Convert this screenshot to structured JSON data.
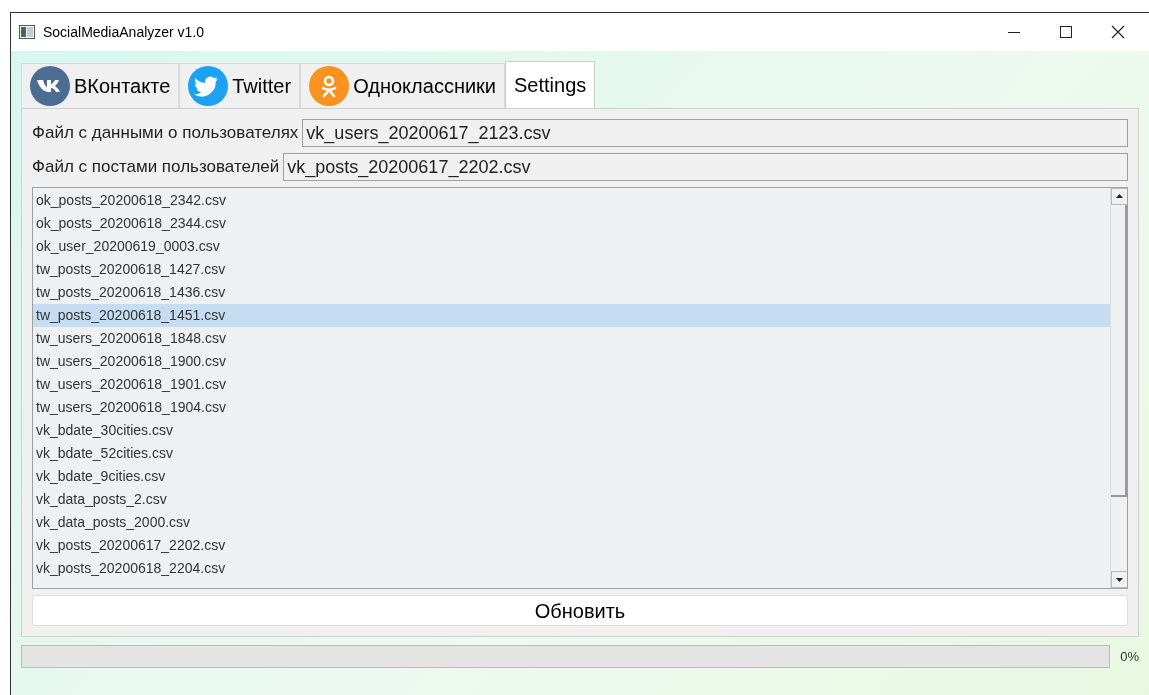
{
  "window": {
    "title": "SocialMediaAnalyzer v1.0"
  },
  "tabs": [
    {
      "label": "ВКонтакте",
      "kind": "vk",
      "selected": false
    },
    {
      "label": "Twitter",
      "kind": "twitter",
      "selected": false
    },
    {
      "label": "Одноклассники",
      "kind": "ok",
      "selected": false
    },
    {
      "label": "Settings",
      "kind": "plain",
      "selected": true
    }
  ],
  "fields": [
    {
      "label": "Файл с данными о пользователях",
      "value": "vk_users_20200617_2123.csv"
    },
    {
      "label": "Файл с постами пользователей",
      "value": "vk_posts_20200617_2202.csv"
    }
  ],
  "files": [
    {
      "name": "ok_posts_20200618_2342.csv",
      "selected": false
    },
    {
      "name": "ok_posts_20200618_2344.csv",
      "selected": false
    },
    {
      "name": "ok_user_20200619_0003.csv",
      "selected": false
    },
    {
      "name": "tw_posts_20200618_1427.csv",
      "selected": false
    },
    {
      "name": "tw_posts_20200618_1436.csv",
      "selected": false
    },
    {
      "name": "tw_posts_20200618_1451.csv",
      "selected": true
    },
    {
      "name": "tw_users_20200618_1848.csv",
      "selected": false
    },
    {
      "name": "tw_users_20200618_1900.csv",
      "selected": false
    },
    {
      "name": "tw_users_20200618_1901.csv",
      "selected": false
    },
    {
      "name": "tw_users_20200618_1904.csv",
      "selected": false
    },
    {
      "name": "vk_bdate_30cities.csv",
      "selected": false
    },
    {
      "name": "vk_bdate_52cities.csv",
      "selected": false
    },
    {
      "name": "vk_bdate_9cities.csv",
      "selected": false
    },
    {
      "name": "vk_data_posts_2.csv",
      "selected": false
    },
    {
      "name": "vk_data_posts_2000.csv",
      "selected": false
    },
    {
      "name": "vk_posts_20200617_2202.csv",
      "selected": false
    },
    {
      "name": "vk_posts_20200618_2204.csv",
      "selected": false
    }
  ],
  "refresh_button": "Обновить",
  "progress": {
    "level": 0,
    "reading": "0%"
  }
}
